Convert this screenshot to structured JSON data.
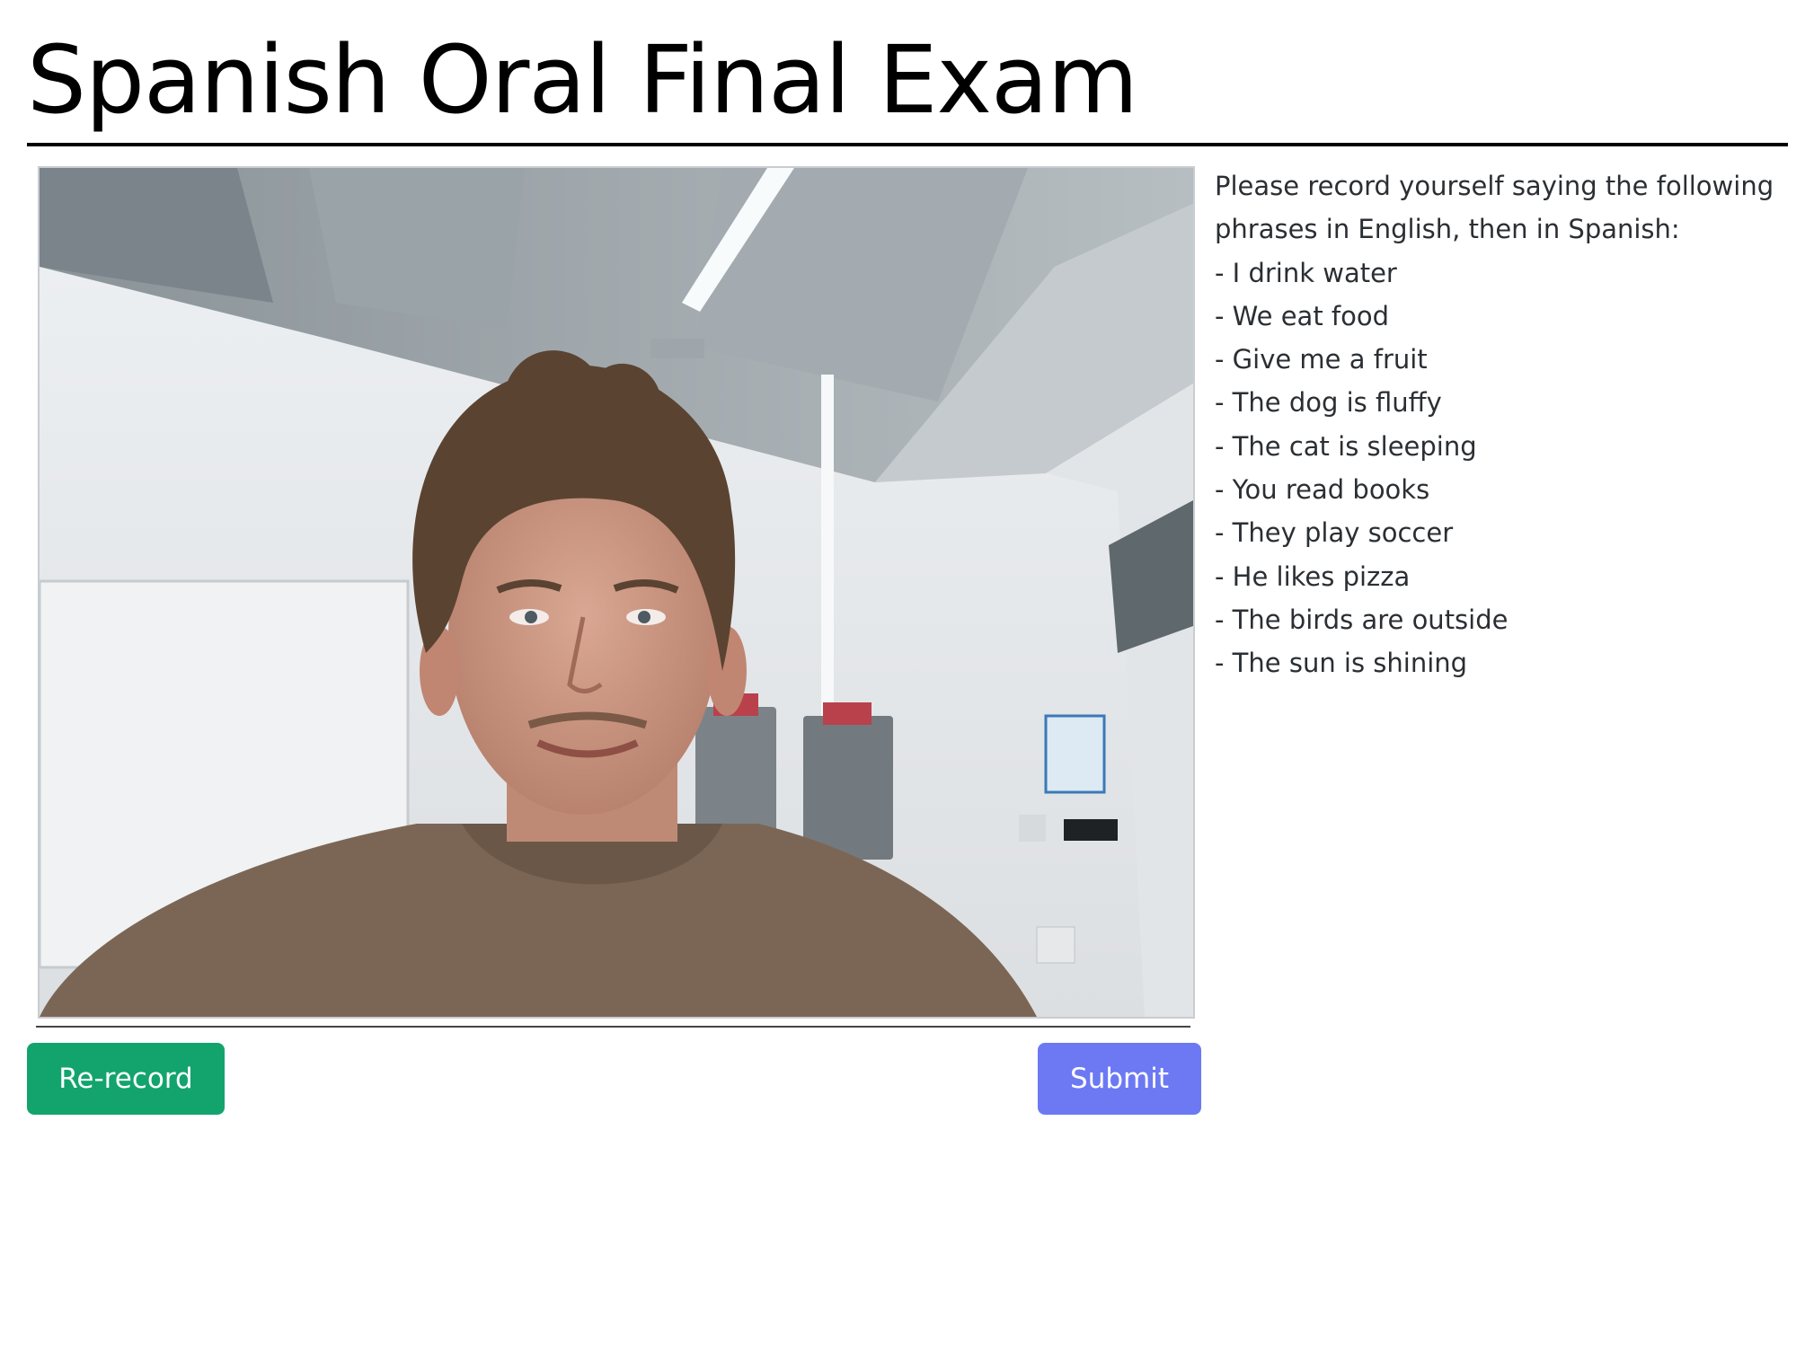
{
  "page": {
    "title": "Spanish Oral Final Exam"
  },
  "video": {
    "content": "webcam-recording"
  },
  "instructions": {
    "text": "Please record yourself saying the following phrases in English, then in Spanish:",
    "phrases": [
      "- I drink water",
      "- We eat food",
      "- Give me a fruit",
      "- The dog is fluffy",
      "- The cat is sleeping",
      "- You read books",
      "- They play soccer",
      "- He likes pizza",
      "- The birds are outside",
      "- The sun is shining"
    ]
  },
  "actions": {
    "rerecord_label": "Re-record",
    "submit_label": "Submit"
  },
  "colors": {
    "rerecord_button": "#13a46e",
    "submit_button": "#6c79f3",
    "title_text": "#000000",
    "body_text": "#2b2f33"
  }
}
